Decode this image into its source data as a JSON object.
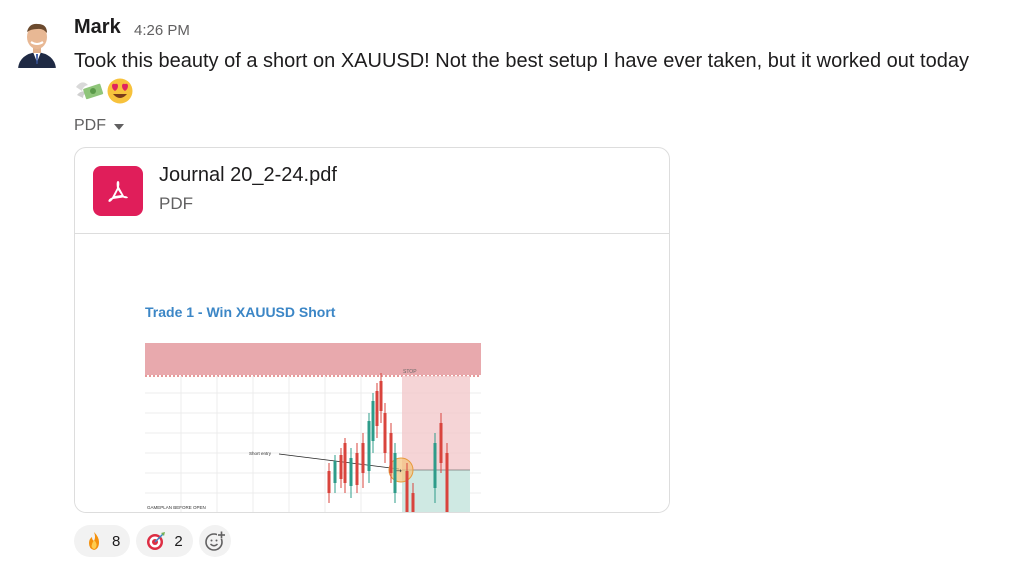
{
  "message": {
    "author": "Mark",
    "time": "4:26 PM",
    "text": "Took this beauty of a short on XAUUSD! Not the best setup I have ever taken, but it worked out today",
    "emojis": [
      "money-with-wings",
      "heart-eyes"
    ]
  },
  "attachment": {
    "toggle_label": "PDF",
    "file_name": "Journal 20_2-24.pdf",
    "file_type": "PDF",
    "preview": {
      "title": "Trade 1 - Win XAUUSD Short",
      "chart_labels": {
        "stop": "STOP",
        "entry": "Short entry",
        "gameplan": "GAMEPLAN BEFORE OPEN"
      }
    }
  },
  "reactions": [
    {
      "emoji": "fire",
      "count": "8"
    },
    {
      "emoji": "direct-hit",
      "count": "2"
    }
  ],
  "colors": {
    "brand_pdf": "#e01e5a",
    "link_blue": "#3b86c6",
    "stop_zone": "#e8a9ad",
    "target_zone": "#cfe9e3",
    "candle_up": "#2e9c8a",
    "candle_down": "#d9443d"
  }
}
